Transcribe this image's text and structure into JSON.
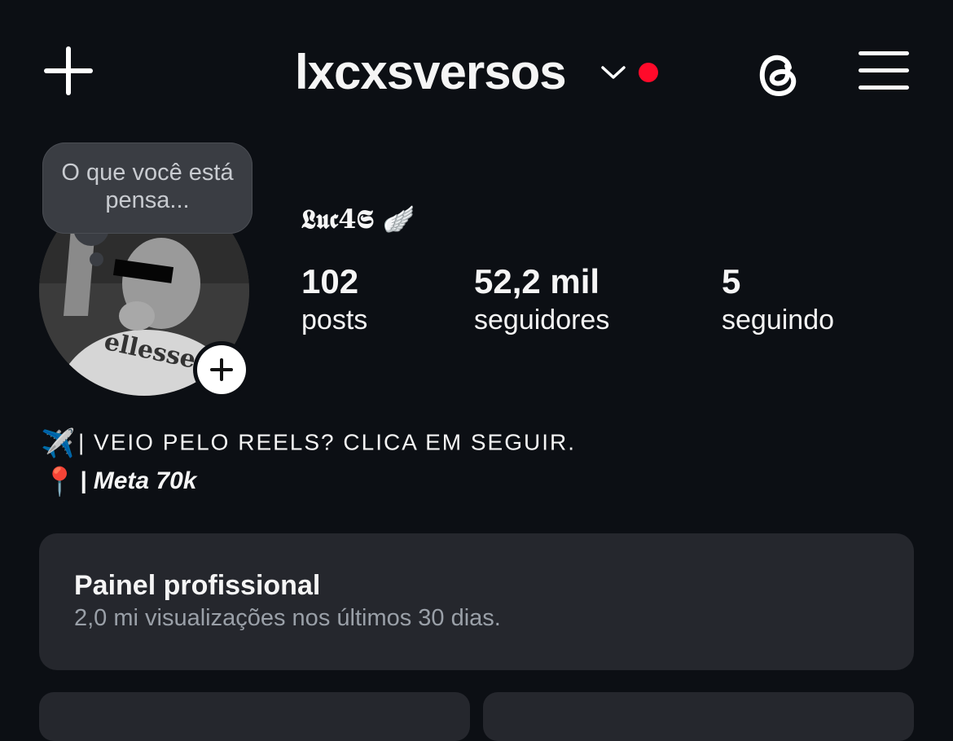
{
  "header": {
    "username": "lxcxsversos",
    "icons": {
      "create": "plus-icon",
      "switch": "chevron-down-icon",
      "threads": "threads-icon",
      "menu": "hamburger-menu-icon"
    },
    "notification_color": "#ff0a2a"
  },
  "note": {
    "text": "O que você está pensa..."
  },
  "profile": {
    "display_name": "𝕷𝖚𝖈4𝕾 🪽",
    "stats": [
      {
        "value": "102",
        "label": "posts"
      },
      {
        "value": "52,2 mil",
        "label": "seguidores"
      },
      {
        "value": "5",
        "label": "seguindo"
      }
    ]
  },
  "bio": {
    "lines": [
      {
        "emoji": "✈️",
        "text": "| VEIO PELO REELS? CLICA EM SEGUIR."
      },
      {
        "emoji": "📍",
        "text": "| Meta 70k"
      }
    ]
  },
  "dashboard": {
    "title": "Painel profissional",
    "subtitle": "2,0 mi visualizações nos últimos 30 dias."
  },
  "colors": {
    "background": "#0c0f14",
    "card": "#25272d",
    "note_bubble": "#3a3d43"
  }
}
